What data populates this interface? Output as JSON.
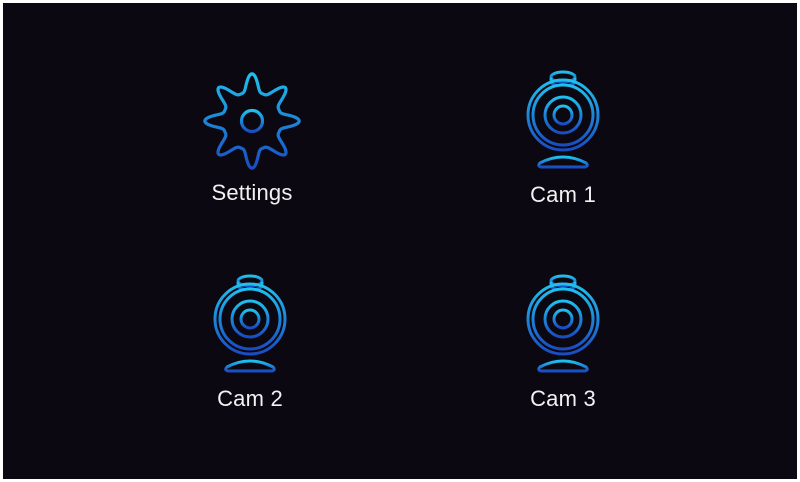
{
  "tiles": [
    {
      "label": "Settings",
      "icon": "gear-icon"
    },
    {
      "label": "Cam 1",
      "icon": "webcam-icon"
    },
    {
      "label": "Cam 2",
      "icon": "webcam-icon"
    },
    {
      "label": "Cam 3",
      "icon": "webcam-icon"
    }
  ],
  "colors": {
    "background": "#0b0812",
    "icon_light": "#1fb6e8",
    "icon_dark": "#1a4fc4",
    "label": "#f2f2f2"
  }
}
